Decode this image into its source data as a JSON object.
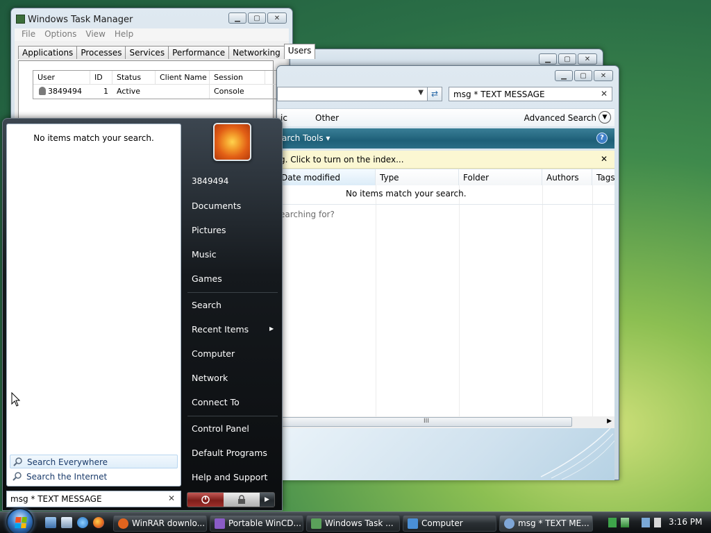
{
  "task_manager": {
    "title": "Windows Task Manager",
    "menu": [
      "File",
      "Options",
      "View",
      "Help"
    ],
    "tabs": [
      "Applications",
      "Processes",
      "Services",
      "Performance",
      "Networking",
      "Users"
    ],
    "active_tab": "Users",
    "columns": [
      "User",
      "ID",
      "Status",
      "Client Name",
      "Session"
    ],
    "rows": [
      {
        "user": "3849494",
        "id": "1",
        "status": "Active",
        "client_name": "",
        "session": "Console"
      }
    ]
  },
  "search_window": {
    "search_text": "msg * TEXT MESSAGE",
    "filters": [
      "ic",
      "Other"
    ],
    "advanced_search": "Advanced Search",
    "toolbar_label": "arch Tools ▾",
    "info_bar": "g.  Click to turn on the index...",
    "columns": [
      "Date modified",
      "Type",
      "Folder",
      "Authors",
      "Tags"
    ],
    "no_items": "No items match your search.",
    "searching_for": "earching for?"
  },
  "start_menu": {
    "no_items": "No items match your search.",
    "search_everywhere": "Search Everywhere",
    "search_internet": "Search the Internet",
    "search_value": "msg * TEXT MESSAGE",
    "username": "3849494",
    "right_items_group1": [
      "Documents",
      "Pictures",
      "Music",
      "Games"
    ],
    "right_items_group2": [
      "Search",
      "Recent Items",
      "Computer",
      "Network",
      "Connect To"
    ],
    "right_items_group3": [
      "Control Panel",
      "Default Programs",
      "Help and Support"
    ]
  },
  "taskbar": {
    "buttons": [
      {
        "label": "WinRAR downlo...",
        "color": "#e2641e"
      },
      {
        "label": "Portable WinCD...",
        "color": "#8a5cc7"
      },
      {
        "label": "Windows Task ...",
        "color": "#5aa05a"
      },
      {
        "label": "Computer",
        "color": "#4a8fd6"
      },
      {
        "label": "msg * TEXT ME...",
        "color": "#7fa6d6"
      }
    ],
    "clock": "3:16 PM"
  }
}
